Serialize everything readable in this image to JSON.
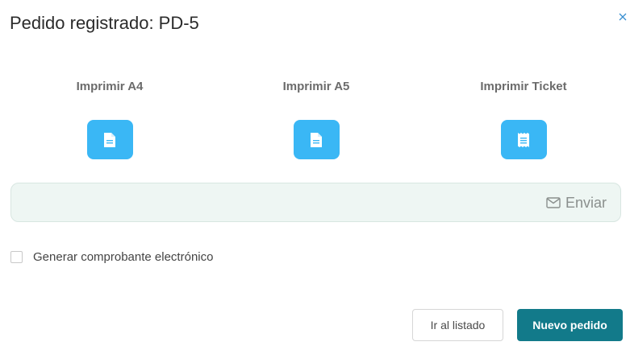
{
  "dialog": {
    "title": "Pedido registrado: PD-5",
    "close_icon": "close-icon"
  },
  "print_options": [
    {
      "label": "Imprimir A4",
      "icon": "document-icon"
    },
    {
      "label": "Imprimir A5",
      "icon": "document-icon"
    },
    {
      "label": "Imprimir Ticket",
      "icon": "receipt-icon"
    }
  ],
  "send": {
    "label": "Enviar",
    "icon": "envelope-icon"
  },
  "electronic_receipt": {
    "label": "Generar comprobante electrónico",
    "checked": false
  },
  "footer": {
    "list_label": "Ir al listado",
    "new_order_label": "Nuevo pedido"
  },
  "colors": {
    "print_button": "#3ab7f5",
    "primary_button": "#127a8a",
    "send_box_bg": "#eef6f3"
  }
}
